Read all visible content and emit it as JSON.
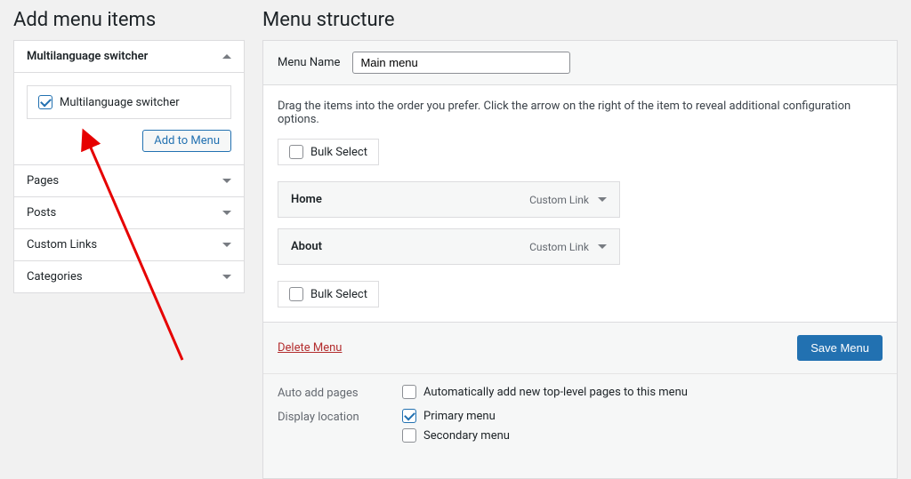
{
  "left": {
    "title": "Add menu items",
    "expanded_section": {
      "label": "Multilanguage switcher",
      "checkbox_label": "Multilanguage switcher",
      "add_button": "Add to Menu"
    },
    "collapsed_sections": [
      "Pages",
      "Posts",
      "Custom Links",
      "Categories"
    ]
  },
  "right": {
    "title": "Menu structure",
    "menu_name_label": "Menu Name",
    "menu_name_value": "Main menu",
    "instructions": "Drag the items into the order you prefer. Click the arrow on the right of the item to reveal additional configuration options.",
    "bulk_select_label": "Bulk Select",
    "menu_items": [
      {
        "title": "Home",
        "type": "Custom Link"
      },
      {
        "title": "About",
        "type": "Custom Link"
      }
    ],
    "delete_menu": "Delete Menu",
    "save_menu": "Save Menu",
    "settings": {
      "auto_pages_label": "Auto add pages",
      "auto_pages_option": "Automatically add new top-level pages to this menu",
      "display_location_label": "Display location",
      "locations": [
        {
          "label": "Primary menu",
          "checked": true
        },
        {
          "label": "Secondary menu",
          "checked": false
        }
      ]
    }
  }
}
